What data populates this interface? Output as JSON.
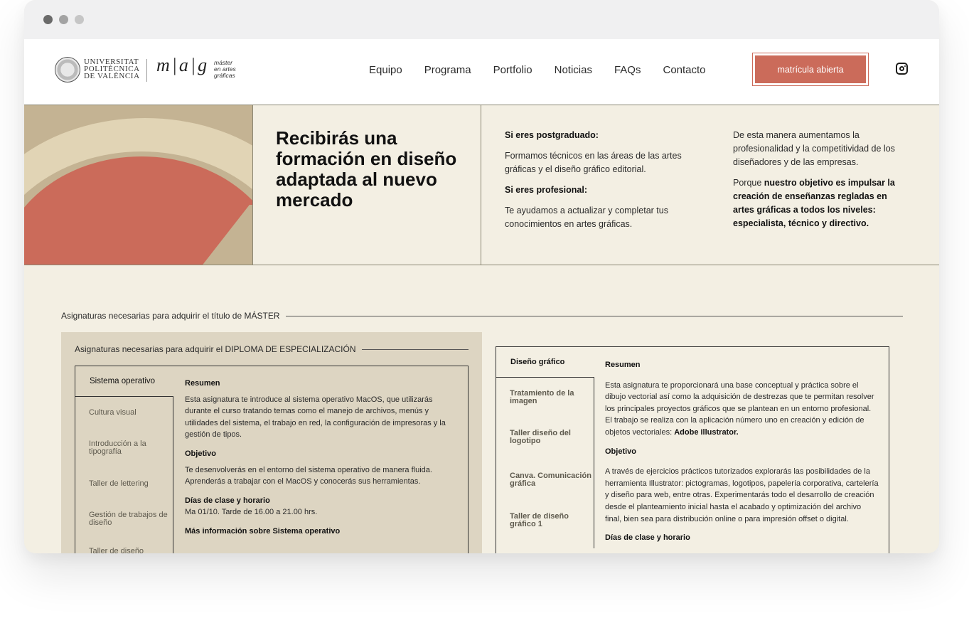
{
  "window": {
    "title": ""
  },
  "header": {
    "logo_upv_lines": [
      "UNIVERSITAT",
      "POLITÈCNICA",
      "DE VALÈNCIA"
    ],
    "logo_mag": "m|a|g",
    "logo_mag_sub": [
      "máster",
      "en artes",
      "gráficas"
    ],
    "nav": [
      "Equipo",
      "Programa",
      "Portfolio",
      "Noticias",
      "FAQs",
      "Contacto"
    ],
    "cta_label": "matrícula abierta",
    "social_icon": "instagram-icon"
  },
  "hero": {
    "title": "Recibirás una formación en diseño adaptada al nuevo mercado",
    "col1": {
      "h1": "Si eres postgraduado:",
      "p1": "Formamos técnicos en las áreas de las artes gráficas y el diseño gráfico editorial.",
      "h2": "Si eres profesional:",
      "p2": "Te ayudamos a actualizar y completar tus conocimientos en artes gráficas."
    },
    "col2": {
      "p1": "De esta manera aumentamos la profesionalidad y la competitividad de los diseñadores y de las empresas.",
      "p2_prefix": "Porque ",
      "p2_bold": "nuestro objetivo es impulsar la creación de enseñanzas regladas en artes gráficas a todos los niveles: especialista, técnico y directivo."
    },
    "colors": {
      "beige": "#c4b393",
      "light": "#e1d4b5",
      "red": "#cb6b5a"
    }
  },
  "master_heading": "Asignaturas necesarias para adquirir el título de MÁSTER",
  "diploma": {
    "heading": "Asignaturas necesarias para adquirir el DIPLOMA DE ESPECIALIZACIÓN",
    "tabs": [
      "Sistema operativo",
      "Cultura visual",
      "Introducción a la tipografía",
      "Taller de lettering",
      "Gestión de trabajos de diseño",
      "Taller de diseño"
    ],
    "active_tab": "Sistema operativo",
    "content": {
      "resumen_h": "Resumen",
      "resumen": "Esta asignatura te introduce al sistema operativo MacOS, que utilizarás durante el curso tratando temas como el manejo de archivos, menús y utilidades del sistema, el trabajo en red, la configuración de impresoras y la gestión de tipos.",
      "objetivo_h": "Objetivo",
      "objetivo": "Te desenvolverás en el entorno del sistema operativo de manera fluida. Aprenderás a trabajar con el MacOS y conocerás sus herramientas.",
      "dias_h": "Días de clase y horario",
      "dias": "Ma 01/10. Tarde de 16.00 a 21.00 hrs.",
      "mas_info": "Más información sobre Sistema operativo"
    }
  },
  "master": {
    "tabs": [
      "Diseño gráfico",
      "Tratamiento de la imagen",
      "Taller diseño del logotipo",
      "Canva. Comunicación gráfica",
      "Taller de diseño gráfico 1"
    ],
    "active_tab": "Diseño gráfico",
    "content": {
      "resumen_h": "Resumen",
      "resumen": "Esta asignatura te proporcionará una base conceptual y práctica sobre el dibujo vectorial así como la adquisición de destrezas que te permitan resolver los principales proyectos gráficos que se plantean en un entorno profesional. El trabajo se realiza con la aplicación número uno en creación y edición de objetos vectoriales: ",
      "resumen_bold": "Adobe Illustrator.",
      "objetivo_h": "Objetivo",
      "objetivo": "A través de ejercicios prácticos tutorizados explorarás las posibilidades de la herramienta Illustrator: pictogramas, logotipos, papelería corporativa, cartelería y diseño para web, entre otras. Experimentarás todo el desarrollo de creación desde el planteamiento inicial hasta el acabado y optimización del archivo final, bien sea para distribución online o para impresión offset o digital.",
      "dias_h": "Días de clase y horario"
    }
  }
}
